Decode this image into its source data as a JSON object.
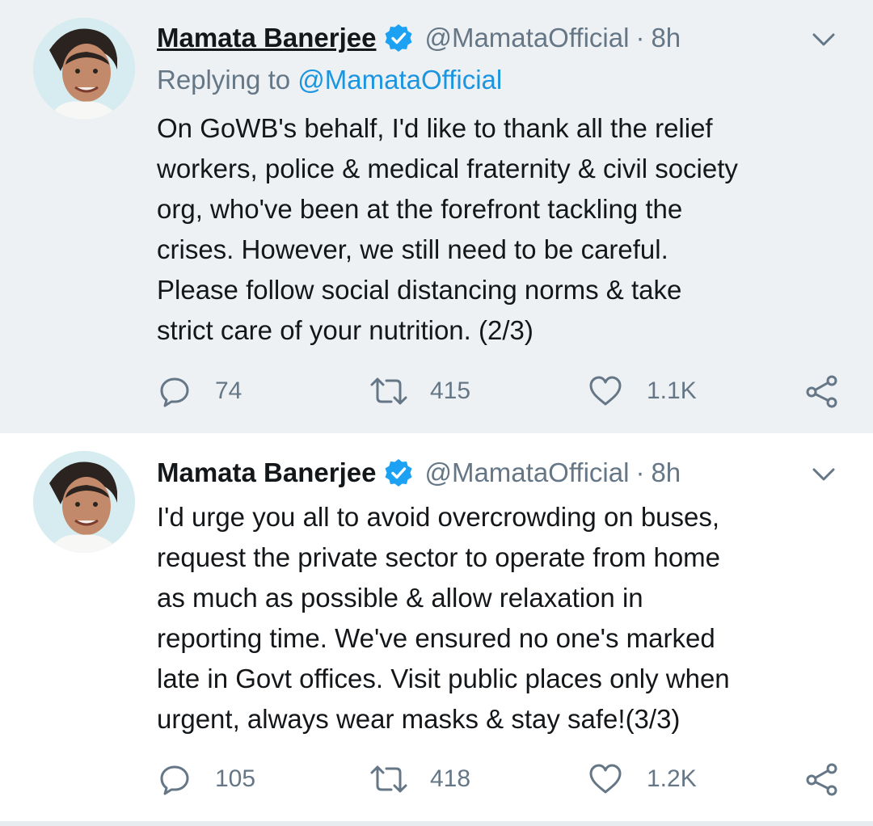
{
  "tweets": [
    {
      "author": {
        "name": "Mamata Banerjee",
        "handle": "@MamataOfficial",
        "verified": true
      },
      "time": "8h",
      "replying_to_prefix": "Replying to",
      "replying_to_handle": "@MamataOfficial",
      "text_lines": [
        "On GoWB's behalf, I'd like to thank all the relief",
        "workers, police & medical fraternity & civil society",
        "org, who've been at the forefront tackling the",
        "crises. However, we still need to be careful.",
        "Please follow social distancing norms & take",
        "strict care of your nutrition. (2/3)"
      ],
      "replies": "74",
      "retweets": "415",
      "likes": "1.1K"
    },
    {
      "author": {
        "name": "Mamata Banerjee",
        "handle": "@MamataOfficial",
        "verified": true
      },
      "time": "8h",
      "text_lines": [
        "I'd urge you all to avoid overcrowding on buses,",
        "request the private sector to operate from home",
        "as much as possible & allow relaxation in",
        "reporting time. We've ensured no one's marked",
        "late in Govt offices. Visit public places only when",
        "urgent, always wear masks & stay safe!(3/3)"
      ],
      "replies": "105",
      "retweets": "418",
      "likes": "1.2K"
    }
  ],
  "icons": {
    "reply": "reply-icon",
    "retweet": "retweet-icon",
    "like": "heart-icon",
    "share": "share-icon",
    "verified": "verified-badge-icon",
    "menu": "chevron-down-icon"
  },
  "colors": {
    "selected_tweet_bg": "#eef1f4",
    "verified_blue": "#1da1f2",
    "link_blue": "#1b95e0",
    "secondary_text": "#657786",
    "primary_text": "#14171a"
  }
}
